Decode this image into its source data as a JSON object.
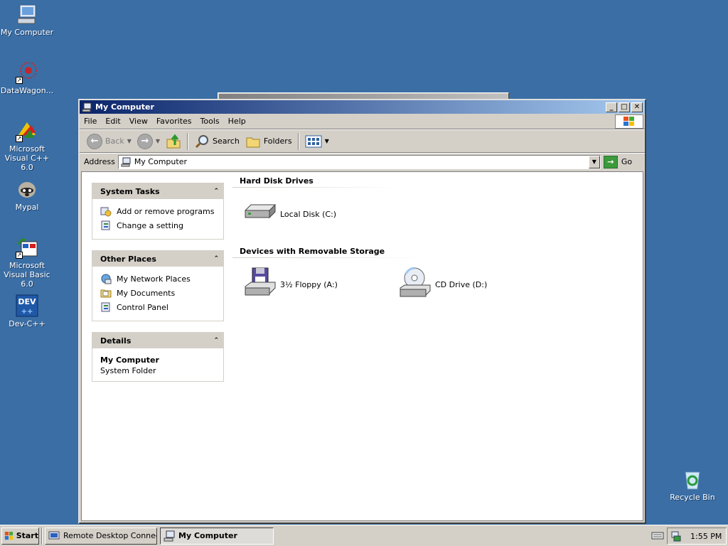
{
  "desktop": {
    "icons": [
      {
        "label": "My Computer",
        "icon": "my-computer-icon"
      },
      {
        "label": "DataWagon...",
        "icon": "datawagon-icon"
      },
      {
        "label": "Microsoft Visual C++ 6.0",
        "icon": "visual-cpp-icon"
      },
      {
        "label": "Mypal",
        "icon": "mypal-icon"
      },
      {
        "label": "Microsoft Visual Basic 6.0",
        "icon": "visual-basic-icon"
      },
      {
        "label": "Dev-C++",
        "icon": "devcpp-icon"
      },
      {
        "label": "Recycle Bin",
        "icon": "recycle-bin-icon"
      }
    ],
    "background_color": "#3a6ea5"
  },
  "window": {
    "title": "My Computer",
    "menu": [
      "File",
      "Edit",
      "View",
      "Favorites",
      "Tools",
      "Help"
    ],
    "toolbar": {
      "back": "Back",
      "search": "Search",
      "folders": "Folders"
    },
    "address": {
      "label": "Address",
      "value": "My Computer",
      "go": "Go"
    }
  },
  "tasks": {
    "system": {
      "title": "System Tasks",
      "items": [
        "Add or remove programs",
        "Change a setting"
      ]
    },
    "places": {
      "title": "Other Places",
      "items": [
        "My Network Places",
        "My Documents",
        "Control Panel"
      ]
    },
    "details": {
      "title": "Details",
      "name": "My Computer",
      "type": "System Folder"
    }
  },
  "groups": {
    "hdd": {
      "title": "Hard Disk Drives",
      "items": [
        "Local Disk (C:)"
      ]
    },
    "removable": {
      "title": "Devices with Removable Storage",
      "items": [
        "3½ Floppy (A:)",
        "CD Drive (D:)"
      ]
    }
  },
  "taskbar": {
    "start": "Start",
    "tasks": [
      "Remote Desktop Connec...",
      "My Computer"
    ],
    "clock": "1:55 PM"
  }
}
